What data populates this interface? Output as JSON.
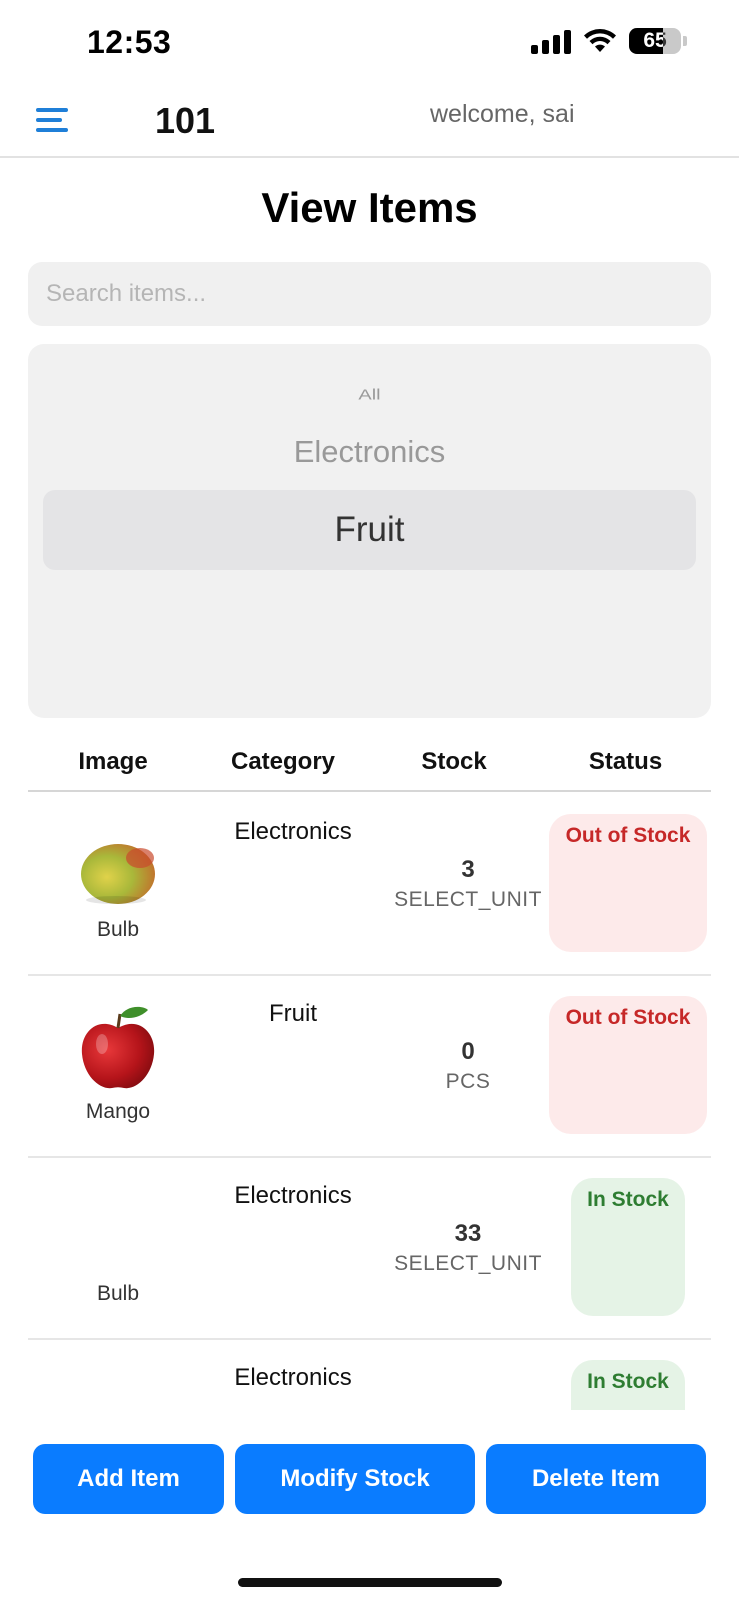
{
  "status_bar": {
    "time": "12:53",
    "battery_level": "65",
    "icons": [
      "signal-icon",
      "wifi-icon",
      "battery-icon"
    ]
  },
  "header": {
    "menu_icon": "menu-icon",
    "title": "101",
    "welcome": "welcome, sai",
    "accent_color": "#1f7fd8"
  },
  "page": {
    "title": "View Items"
  },
  "search": {
    "placeholder": "Search items...",
    "value": ""
  },
  "category_picker": {
    "options": [
      "All",
      "Electronics",
      "Fruit"
    ],
    "selected": "Fruit"
  },
  "table": {
    "columns": [
      "Image",
      "Category",
      "Stock",
      "Status"
    ],
    "rows": [
      {
        "image": "mango-image",
        "name": "Bulb",
        "category": "Electronics",
        "stock": "3",
        "unit": "SELECT_UNIT",
        "status": "Out of Stock"
      },
      {
        "image": "apple-image",
        "name": "Mango",
        "category": "Fruit",
        "stock": "0",
        "unit": "PCS",
        "status": "Out of Stock"
      },
      {
        "image": "",
        "name": "Bulb",
        "category": "Electronics",
        "stock": "33",
        "unit": "SELECT_UNIT",
        "status": "In Stock"
      },
      {
        "image": "",
        "name": "",
        "category": "Electronics",
        "stock": "",
        "unit": "",
        "status": "In Stock"
      }
    ],
    "status_colors": {
      "out_text": "#c62828",
      "out_bg": "#fdeaea",
      "in_text": "#2e7d32",
      "in_bg": "#e5f3e6"
    }
  },
  "actions": {
    "add_label": "Add Item",
    "modify_label": "Modify Stock",
    "delete_label": "Delete Item",
    "button_color": "#0a7cff"
  }
}
